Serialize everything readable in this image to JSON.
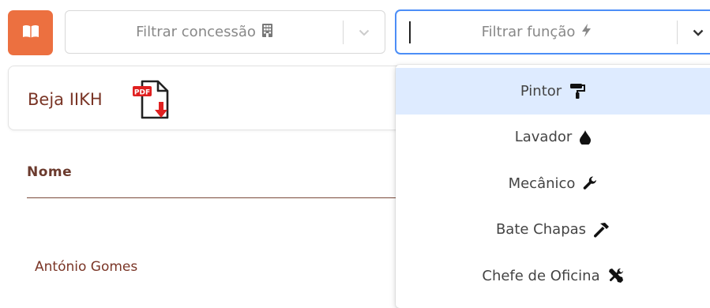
{
  "toolbar": {
    "book_button_icon": "book-open-icon",
    "concessao_select": {
      "placeholder": "Filtrar concessão",
      "icon": "building-icon"
    },
    "funcao_select": {
      "placeholder": "Filtrar função",
      "icon": "bolt-icon",
      "focused": true
    }
  },
  "card": {
    "title": "Beja IIKH",
    "pdf_icon": "pdf-download-icon"
  },
  "table": {
    "headers": [
      "Nome"
    ],
    "rows": [
      [
        "António Gomes"
      ]
    ]
  },
  "dropdown": {
    "options": [
      {
        "label": "Pintor",
        "icon": "paint-roller-icon",
        "highlighted": true
      },
      {
        "label": "Lavador",
        "icon": "tint-drop-icon"
      },
      {
        "label": "Mecânico",
        "icon": "wrench-icon"
      },
      {
        "label": "Bate Chapas",
        "icon": "hammer-icon"
      },
      {
        "label": "Chefe de Oficina",
        "icon": "tools-icon"
      }
    ]
  },
  "colors": {
    "accent": "#ec7040",
    "focus_border": "#4c8ef7",
    "highlight": "#deebff",
    "title_text": "#7a3526"
  }
}
